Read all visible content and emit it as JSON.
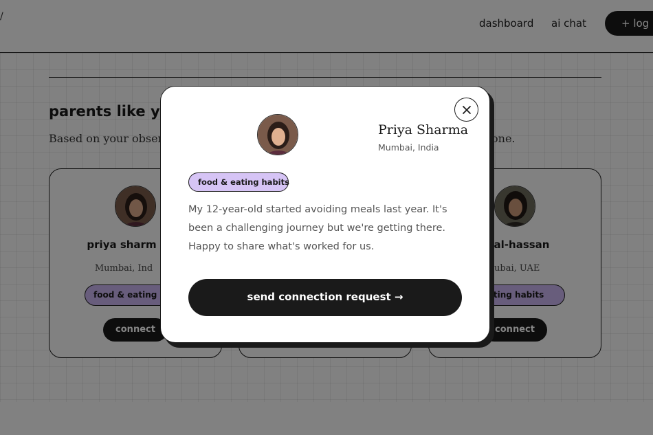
{
  "nav": {
    "logo_mark": "/",
    "dashboard": "dashboard",
    "ai_chat": "ai chat",
    "login": "+ log in"
  },
  "section": {
    "title": "parents like you",
    "subtitle_start": "Based on your observa",
    "subtitle_end": "one."
  },
  "cards": [
    {
      "name": "priya sharm",
      "location": "Mumbai, Ind",
      "tag": "food & eating ha",
      "connect": "connect"
    },
    {
      "name": "na al-hassan",
      "location": "Dubai, UAE",
      "tag": "& eating habits",
      "connect": "connect"
    }
  ],
  "modal": {
    "name": "Priya Sharma",
    "location": "Mumbai, India",
    "tag": "food & eating habits",
    "bio": "My 12-year-old started avoiding meals last year. It's been a challenging journey but we're getting there. Happy to share what's worked for us.",
    "send_button": "send connection request →"
  },
  "colors": {
    "tag_purple": "#c7b2ee",
    "dark": "#1a1a1a",
    "background": "#f7f7f7"
  }
}
